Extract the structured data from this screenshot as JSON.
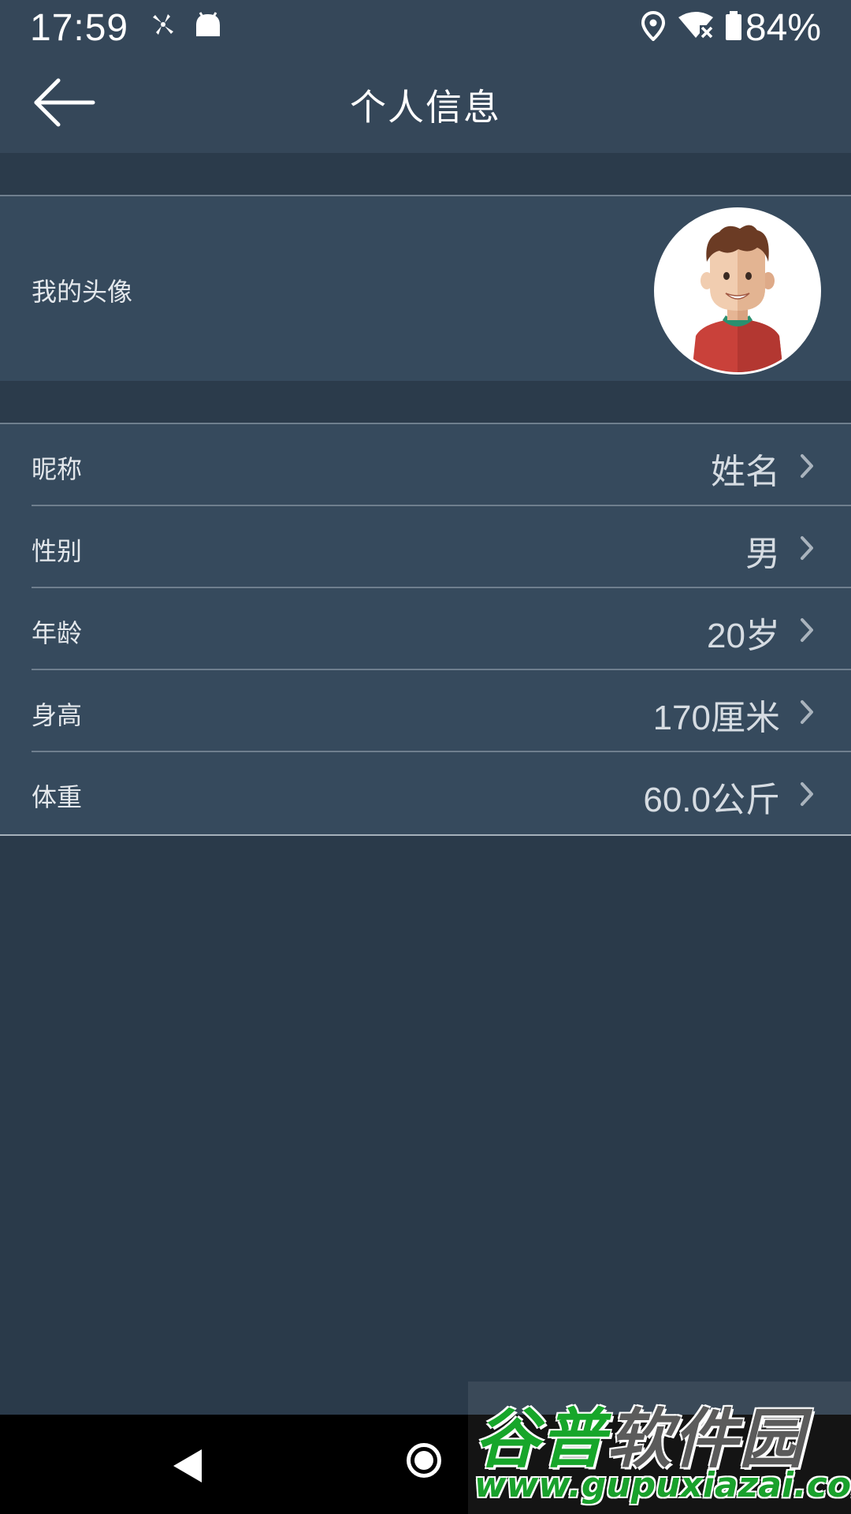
{
  "status_bar": {
    "time": "17:59",
    "battery_percent": "84%",
    "icons": [
      "fan-icon",
      "android-icon",
      "location-icon",
      "wifi-off-icon",
      "battery-icon"
    ]
  },
  "header": {
    "title": "个人信息",
    "back_icon": "arrow-left-icon"
  },
  "avatar_section": {
    "label": "我的头像"
  },
  "info_rows": [
    {
      "label": "昵称",
      "value": "姓名"
    },
    {
      "label": "性别",
      "value": "男"
    },
    {
      "label": "年龄",
      "value": "20岁"
    },
    {
      "label": "身高",
      "value": "170厘米"
    },
    {
      "label": "体重",
      "value": "60.0公斤"
    }
  ],
  "watermark": {
    "line1_part1": "谷普",
    "line1_part2": "软件园",
    "line2": "www.gupuxiazai.com"
  },
  "colors": {
    "bar_bg": "#354759",
    "page_bg": "#2a3a4a",
    "row_bg": "#364a5d",
    "text_light": "#e4e8ec"
  }
}
